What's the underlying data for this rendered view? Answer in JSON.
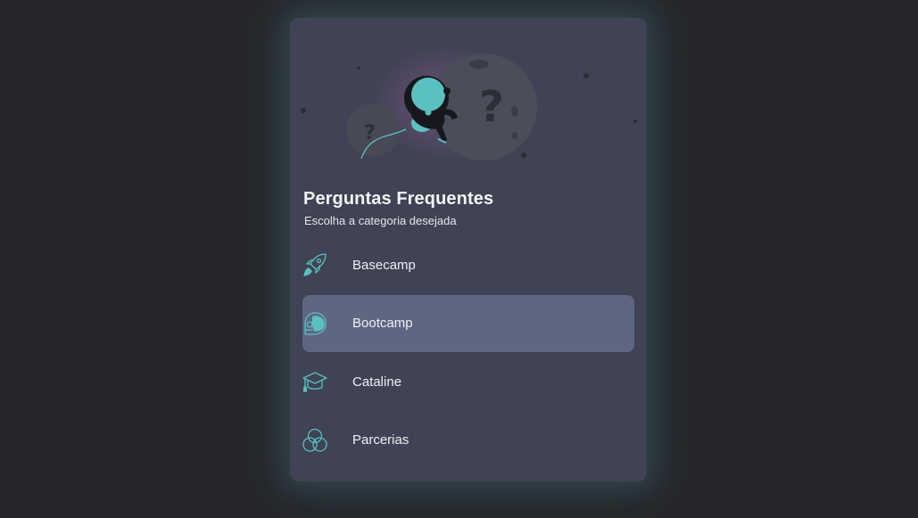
{
  "faq": {
    "title": "Perguntas Frequentes",
    "subtitle": "Escolha a categoria desejada",
    "selected": "Bootcamp",
    "categories": [
      {
        "label": "Basecamp",
        "icon": "rocket-icon"
      },
      {
        "label": "Bootcamp",
        "icon": "astronaut-helmet-icon"
      },
      {
        "label": "Cataline",
        "icon": "graduation-cap-icon"
      },
      {
        "label": "Parcerias",
        "icon": "overlapping-circles-icon"
      }
    ]
  },
  "colors": {
    "background": "#26272c",
    "card": "#3f4353",
    "selected_item": "#5e6681",
    "accent": "#5bc0c2"
  }
}
